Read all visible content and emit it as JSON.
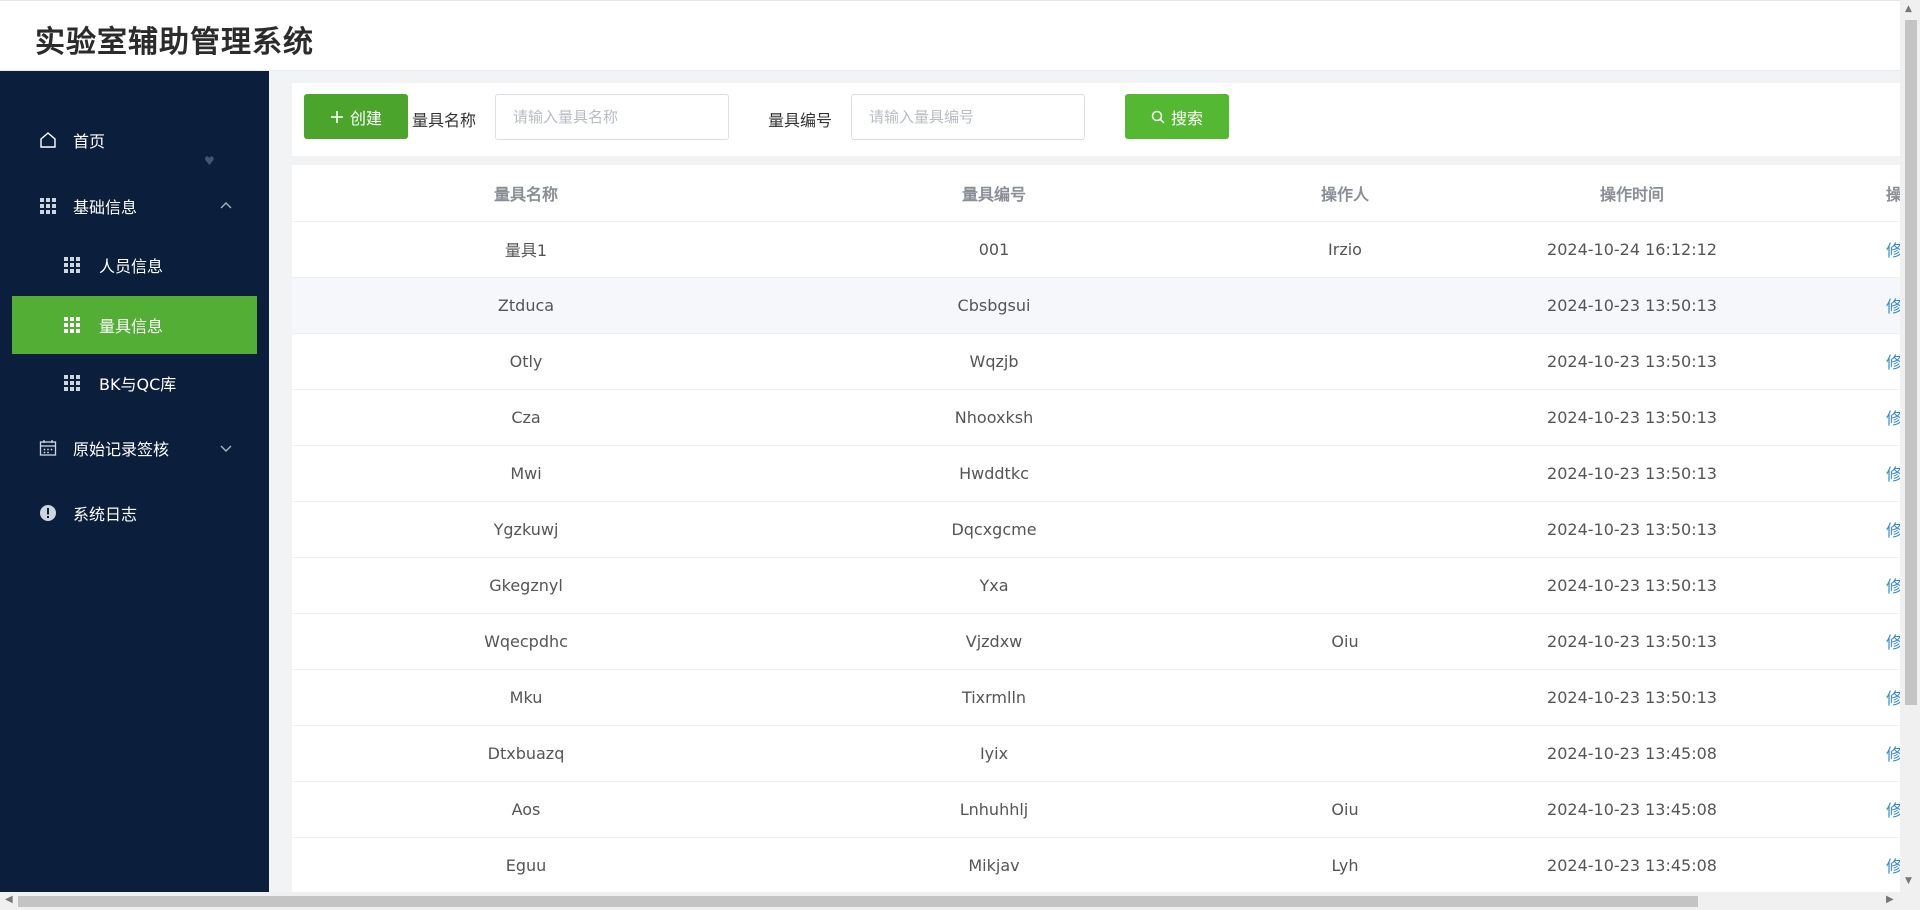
{
  "app": {
    "title": "实验室辅助管理系统"
  },
  "sidebar": {
    "items": [
      {
        "label": "首页",
        "icon": "home-icon"
      },
      {
        "label": "基础信息",
        "icon": "grid-icon",
        "expanded": true
      },
      {
        "label": "人员信息",
        "icon": "grid-icon"
      },
      {
        "label": "量具信息",
        "icon": "grid-icon",
        "active": true
      },
      {
        "label": "BK与QC库",
        "icon": "grid-icon"
      },
      {
        "label": "原始记录签核",
        "icon": "calendar-icon",
        "expanded": false
      },
      {
        "label": "系统日志",
        "icon": "warning-circle-icon"
      }
    ],
    "active_color": "#52ae35",
    "bg_color": "#0b1f3c"
  },
  "toolbar": {
    "create_label": "创建",
    "name_label": "量具名称",
    "name_placeholder": "请输入量具名称",
    "number_label": "量具编号",
    "number_placeholder": "请输入量具编号",
    "search_label": "搜索"
  },
  "table": {
    "headers": [
      "量具名称",
      "量具编号",
      "操作人",
      "操作时间",
      "操作"
    ],
    "rows": [
      {
        "name": "量具1",
        "number": "001",
        "operator": "Irzio",
        "time": "2024-10-24 16:12:12",
        "action": "修改"
      },
      {
        "name": "Ztduca",
        "number": "Cbsbgsui",
        "operator": "",
        "time": "2024-10-23 13:50:13",
        "action": "修改"
      },
      {
        "name": "Otly",
        "number": "Wqzjb",
        "operator": "",
        "time": "2024-10-23 13:50:13",
        "action": "修改"
      },
      {
        "name": "Cza",
        "number": "Nhooxksh",
        "operator": "",
        "time": "2024-10-23 13:50:13",
        "action": "修改"
      },
      {
        "name": "Mwi",
        "number": "Hwddtkc",
        "operator": "",
        "time": "2024-10-23 13:50:13",
        "action": "修改"
      },
      {
        "name": "Ygzkuwj",
        "number": "Dqcxgcme",
        "operator": "",
        "time": "2024-10-23 13:50:13",
        "action": "修改"
      },
      {
        "name": "Gkegznyl",
        "number": "Yxa",
        "operator": "",
        "time": "2024-10-23 13:50:13",
        "action": "修改"
      },
      {
        "name": "Wqecpdhc",
        "number": "Vjzdxw",
        "operator": "Oiu",
        "time": "2024-10-23 13:50:13",
        "action": "修改"
      },
      {
        "name": "Mku",
        "number": "Tixrmlln",
        "operator": "",
        "time": "2024-10-23 13:50:13",
        "action": "修改"
      },
      {
        "name": "Dtxbuazq",
        "number": "Iyix",
        "operator": "",
        "time": "2024-10-23 13:45:08",
        "action": "修改"
      },
      {
        "name": "Aos",
        "number": "Lnhuhhlj",
        "operator": "Oiu",
        "time": "2024-10-23 13:45:08",
        "action": "修改"
      },
      {
        "name": "Eguu",
        "number": "Mikjav",
        "operator": "Lyh",
        "time": "2024-10-23 13:45:08",
        "action": "修改"
      }
    ]
  },
  "colors": {
    "primary_green": "#4ba52c",
    "link_blue": "#2f86d3"
  }
}
